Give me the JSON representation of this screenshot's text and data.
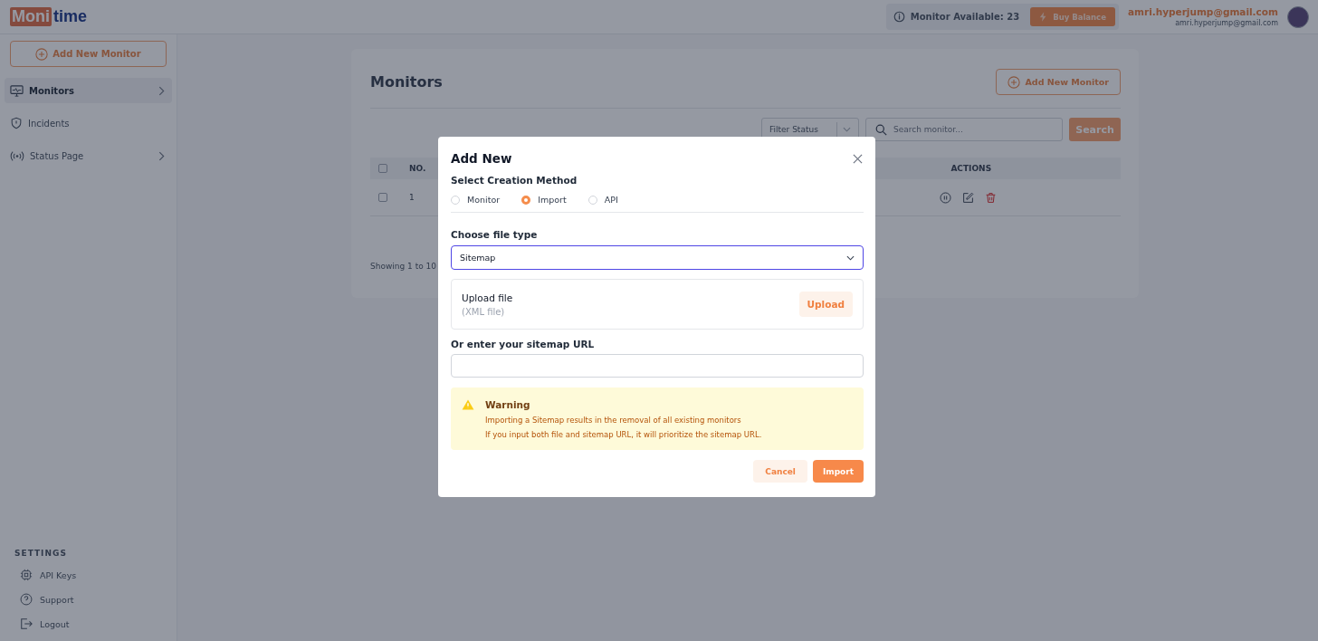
{
  "header": {
    "logo": {
      "part_1": "Moni",
      "part_2": "time"
    },
    "monitor_available": "Monitor Available: 23",
    "buy_button": "Buy Balance",
    "user_name": "amri.hyperjump@gmail.com",
    "user_email": "amri.hyperjump@gmail.com"
  },
  "sidebar": {
    "add_button": "Add New Monitor",
    "items": [
      {
        "label": "Monitors",
        "selected": true,
        "has_submenu": true
      },
      {
        "label": "Incidents",
        "selected": false,
        "has_submenu": false
      },
      {
        "label": "Status Page",
        "selected": false,
        "has_submenu": true
      }
    ],
    "settings_title": "SETTINGS",
    "settings_items": [
      {
        "label": "API Keys"
      },
      {
        "label": "Support"
      },
      {
        "label": "Logout"
      }
    ]
  },
  "main": {
    "title": "Monitors",
    "add_button": "Add New Monitor",
    "filter": {
      "placeholder": "Filter Status"
    },
    "search": {
      "placeholder": "Search monitor..."
    },
    "search_button": "Search",
    "table": {
      "header_checked": false,
      "columns": [
        "NO.",
        "ACTIONS"
      ],
      "rows": [
        {
          "no": "1",
          "checked": false
        }
      ]
    },
    "footer": "Showing 1 to 10"
  },
  "dialog": {
    "title": "Add New",
    "method_label": "Select Creation Method",
    "methods": [
      {
        "label": "Monitor",
        "selected": false
      },
      {
        "label": "Import",
        "selected": true
      },
      {
        "label": "API",
        "selected": false
      }
    ],
    "file_type_label": "Choose file type",
    "file_type": "Sitemap",
    "upload_title": "Upload file",
    "upload_hint": "(XML file)",
    "upload_button": "Upload",
    "url_label": "Or enter your sitemap URL",
    "warning": {
      "title": "Warning",
      "lines": [
        "Importing a Sitemap results in the removal of all existing monitors",
        "If you input both file and sitemap URL, it will prioritize the sitemap URL."
      ]
    },
    "buttons": {
      "cancel": "Cancel",
      "import": "Import"
    }
  }
}
